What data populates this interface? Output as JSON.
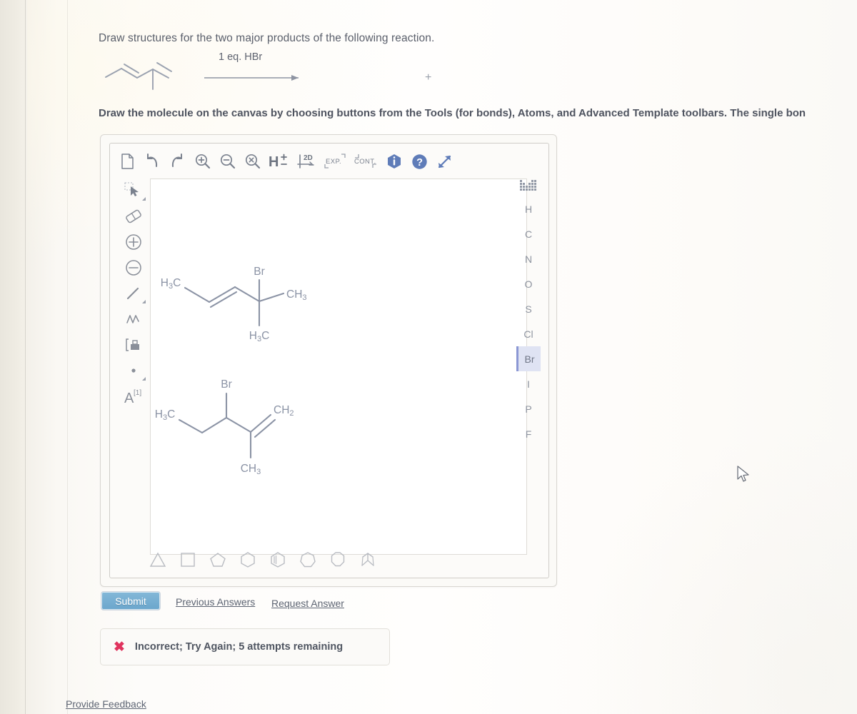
{
  "question": {
    "prompt": "Draw structures for the two major products of the following reaction.",
    "instruction": "Draw the molecule on the canvas by choosing buttons from the Tools (for bonds), Atoms, and Advanced Template toolbars. The single bon",
    "reaction": {
      "conditions": "1 eq. HBr",
      "plus": "+",
      "reactant_name": "2-methyl-1,3-pentadiene"
    }
  },
  "editor": {
    "top_toolbar": [
      {
        "name": "new-document",
        "label": "New"
      },
      {
        "name": "undo",
        "label": "Undo"
      },
      {
        "name": "redo",
        "label": "Redo"
      },
      {
        "name": "zoom-in",
        "label": "Zoom In"
      },
      {
        "name": "zoom-out",
        "label": "Zoom Out"
      },
      {
        "name": "zoom-reset",
        "label": "Reset Zoom"
      },
      {
        "name": "hydrogens-toggle",
        "label": "H±"
      },
      {
        "name": "clean-2d",
        "label": "2D"
      },
      {
        "name": "expand-groups",
        "label": "EXP."
      },
      {
        "name": "contract-groups",
        "label": "CONT."
      },
      {
        "name": "info",
        "label": "Info"
      },
      {
        "name": "help",
        "label": "Help"
      },
      {
        "name": "fullscreen",
        "label": "Expand"
      }
    ],
    "tools_toolbar": [
      {
        "name": "select-tool",
        "label": "Select"
      },
      {
        "name": "eraser-tool",
        "label": "Eraser"
      },
      {
        "name": "increase-charge",
        "label": "Add Charge"
      },
      {
        "name": "decrease-charge",
        "label": "Remove Charge"
      },
      {
        "name": "single-bond",
        "label": "Single Bond"
      },
      {
        "name": "chain-tool",
        "label": "Chain"
      },
      {
        "name": "bracket-tool",
        "label": "Bracket"
      },
      {
        "name": "radical-tool",
        "label": "Radical"
      },
      {
        "name": "atom-label-tool",
        "label": "A[1]"
      }
    ],
    "atoms_toolbar": {
      "periodic_table_label": "Periodic Table",
      "elements": [
        "H",
        "C",
        "N",
        "O",
        "S",
        "Cl",
        "Br",
        "I",
        "P",
        "F"
      ],
      "selected": "Br",
      "selected_bg": "#dfe3f3",
      "selected_border": "#8b97d4"
    },
    "templates_toolbar": [
      {
        "name": "cyclopropane-template",
        "label": "Cyclopropane",
        "sides": 3
      },
      {
        "name": "cyclobutane-template",
        "label": "Cyclobutane",
        "sides": 4
      },
      {
        "name": "cyclopentane-template",
        "label": "Cyclopentane",
        "sides": 5
      },
      {
        "name": "cyclohexane-template",
        "label": "Cyclohexane",
        "sides": 6
      },
      {
        "name": "benzene-template",
        "label": "Benzene",
        "sides": 6
      },
      {
        "name": "cycloheptane-template",
        "label": "Cycloheptane",
        "sides": 7
      },
      {
        "name": "cyclooctane-template",
        "label": "Cyclooctane",
        "sides": 8
      },
      {
        "name": "advanced-template",
        "label": "Advanced Template"
      }
    ],
    "canvas": {
      "molecules": [
        {
          "name": "product-1",
          "labels": [
            "H₃C",
            "Br",
            "CH₃",
            "H₃C"
          ],
          "description": "4-bromo-4-methyl-2-pentene"
        },
        {
          "name": "product-2",
          "labels": [
            "Br",
            "H₃C",
            "CH₂",
            "CH₃"
          ],
          "description": "3-bromo-2-methyl-1-pentene"
        }
      ]
    }
  },
  "actions": {
    "submit_label": "Submit",
    "previous_answers_label": "Previous Answers",
    "request_answer_label": "Request Answer",
    "provide_feedback_label": "Provide Feedback"
  },
  "status": {
    "icon": "x-mark",
    "message": "Incorrect; Try Again; 5 attempts remaining",
    "icon_color": "#e0335e"
  },
  "colors": {
    "page_bg": "#fbfaf7",
    "molecule_stroke": "#8b93a5",
    "text": "#5a5f6b",
    "accent_blue": "#5b7fc4",
    "submit_bg": "#6ba6cc"
  }
}
